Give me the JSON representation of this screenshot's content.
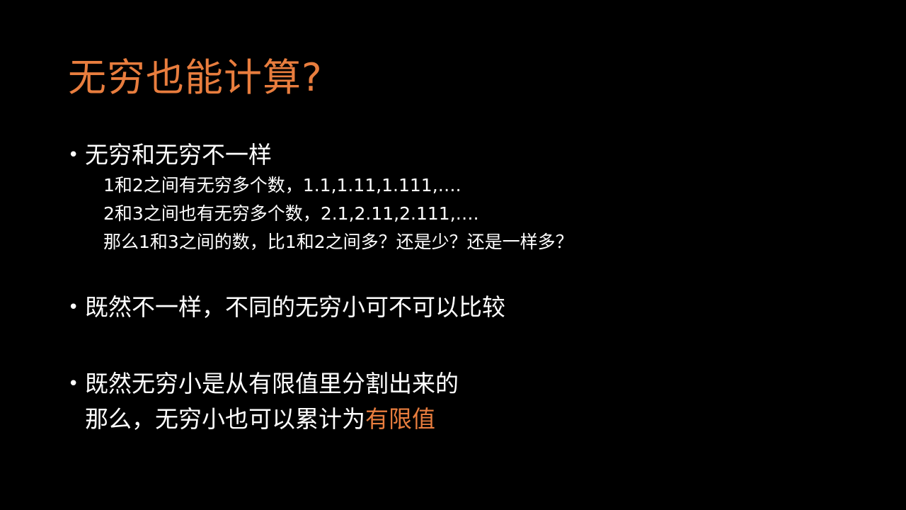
{
  "colors": {
    "background": "#000000",
    "text": "#ffffff",
    "accent": "#e87d3e"
  },
  "slide": {
    "title": "无穷也能计算?",
    "bullet_char": "•",
    "bullets": [
      {
        "text": "无穷和无穷不一样",
        "sub_lines": [
          "1和2之间有无穷多个数，1.1,1.11,1.111,….",
          "2和3之间也有无穷多个数，2.1,2.11,2.111,….",
          "那么1和3之间的数，比1和2之间多？还是少？还是一样多？"
        ]
      },
      {
        "text": "既然不一样，不同的无穷小可不可以比较"
      },
      {
        "text": "既然无穷小是从有限值里分割出来的",
        "continuation_plain": "那么，无穷小也可以累计为",
        "continuation_highlight": "有限值"
      }
    ]
  }
}
